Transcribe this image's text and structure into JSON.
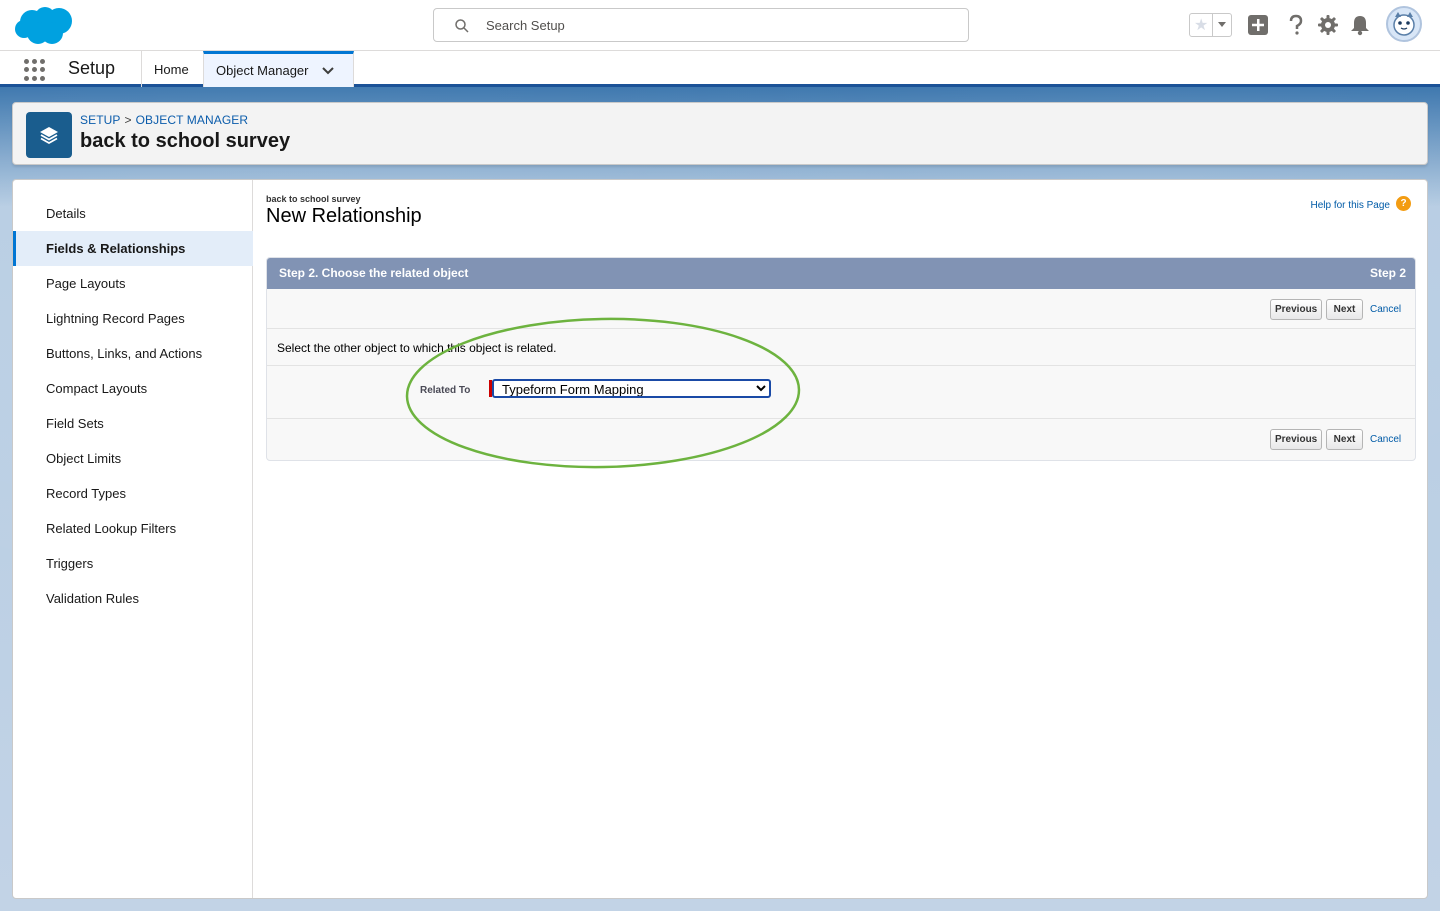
{
  "header": {
    "search_placeholder": "Search Setup",
    "icons": [
      "salesforce-cloud-logo",
      "star-icon",
      "chevron-down-icon",
      "plus-icon",
      "help-icon",
      "gear-icon",
      "bell-icon",
      "avatar"
    ]
  },
  "context_bar": {
    "app_name": "Setup",
    "tabs": [
      {
        "label": "Home",
        "active": false
      },
      {
        "label": "Object Manager",
        "active": true
      }
    ]
  },
  "page_header": {
    "breadcrumb": [
      "SETUP",
      "OBJECT MANAGER"
    ],
    "breadcrumb_separator": ">",
    "title": "back to school survey"
  },
  "sidebar": {
    "items": [
      {
        "label": "Details",
        "active": false
      },
      {
        "label": "Fields & Relationships",
        "active": true
      },
      {
        "label": "Page Layouts",
        "active": false
      },
      {
        "label": "Lightning Record Pages",
        "active": false
      },
      {
        "label": "Buttons, Links, and Actions",
        "active": false
      },
      {
        "label": "Compact Layouts",
        "active": false
      },
      {
        "label": "Field Sets",
        "active": false
      },
      {
        "label": "Object Limits",
        "active": false
      },
      {
        "label": "Record Types",
        "active": false
      },
      {
        "label": "Related Lookup Filters",
        "active": false
      },
      {
        "label": "Triggers",
        "active": false
      },
      {
        "label": "Validation Rules",
        "active": false
      }
    ]
  },
  "main": {
    "object_label": "back to school survey",
    "title": "New Relationship",
    "help_link": "Help for this Page",
    "help_icon_glyph": "?",
    "step": {
      "title": "Step 2. Choose the related object",
      "counter": "Step 2",
      "instruction": "Select the other object to which this object is related.",
      "field_label": "Related To",
      "selected_value": "Typeform Form Mapping",
      "buttons": {
        "previous": "Previous",
        "next": "Next",
        "cancel": "Cancel"
      }
    }
  },
  "colors": {
    "brand_blue": "#0176d3",
    "step_header": "#8193b4",
    "highlight_green": "#6db33f",
    "required_red": "#cc0000"
  }
}
